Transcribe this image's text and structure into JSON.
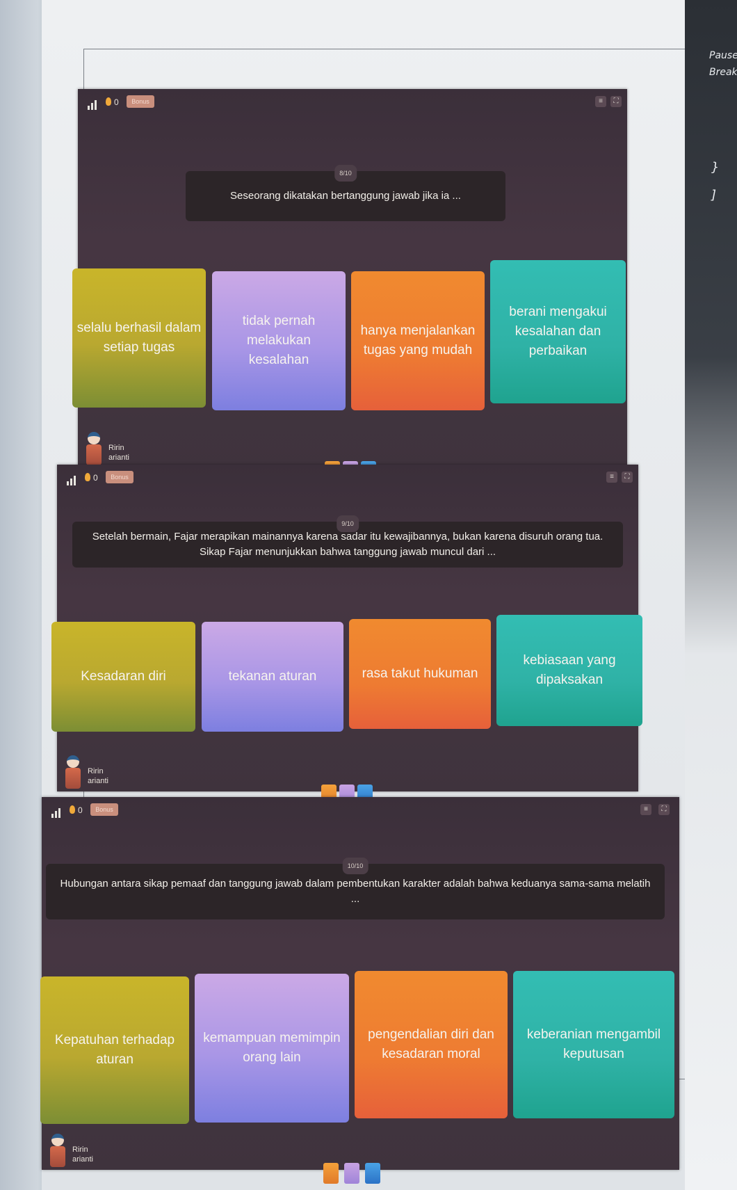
{
  "keyboard": {
    "key1": "Pause",
    "key2": "Break",
    "key3": "}",
    "key4": "]"
  },
  "panels": [
    {
      "counter": "8/10",
      "question": "Seseorang dikatakan bertanggung jawab jika ia ...",
      "bonus_label": "Bonus",
      "streak": "0",
      "answers": [
        "selalu berhasil dalam setiap tugas",
        "tidak pernah melakukan kesalahan",
        "hanya menjalankan tugas yang mudah",
        "berani mengakui kesalahan dan perbaikan"
      ],
      "player": {
        "first": "Ririn",
        "last": "arianti"
      }
    },
    {
      "counter": "9/10",
      "question": "Setelah bermain, Fajar merapikan mainannya karena sadar itu kewajibannya, bukan karena disuruh orang tua. Sikap Fajar menunjukkan bahwa tanggung jawab muncul dari ...",
      "bonus_label": "Bonus",
      "streak": "0",
      "answers": [
        "Kesadaran diri",
        "tekanan aturan",
        "rasa takut hukuman",
        "kebiasaan yang dipaksakan"
      ],
      "player": {
        "first": "Ririn",
        "last": "arianti"
      }
    },
    {
      "counter": "10/10",
      "question": "Hubungan antara sikap pemaaf dan tanggung jawab dalam pembentukan karakter adalah bahwa keduanya sama-sama melatih ...",
      "bonus_label": "Bonus",
      "streak": "0",
      "answers": [
        "Kepatuhan terhadap aturan",
        "kemampuan memimpin orang lain",
        "pengendalian diri dan kesadaran moral",
        "keberanian mengambil keputusan"
      ],
      "player": {
        "first": "Ririn",
        "last": "arianti"
      }
    }
  ],
  "icons": {
    "signal": "signal-bars-icon",
    "streak": "flame-icon",
    "menu": "menu-icon",
    "fullscreen": "fullscreen-icon",
    "powerups": [
      "powerup-orange-icon",
      "powerup-purple-icon",
      "powerup-blue-icon"
    ]
  },
  "colors": {
    "panel_bg": "#3f333d",
    "answer_yellow": "#c9b52a",
    "answer_purple": "#a996e6",
    "answer_orange": "#ee7b32",
    "answer_teal": "#2fb2a6"
  }
}
